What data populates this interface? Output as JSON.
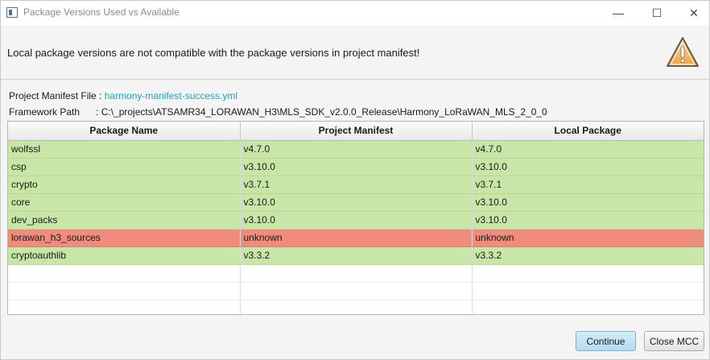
{
  "window": {
    "title": "Package Versions Used vs Available",
    "controls": {
      "minimize": "—",
      "maximize": "☐",
      "close": "✕"
    }
  },
  "header": {
    "message": "Local package versions are not compatible with the package versions in project manifest!",
    "icon": "warning-icon"
  },
  "info": {
    "manifest_label": "Project Manifest File :",
    "manifest_value": "harmony-manifest-success.yml",
    "framework_label": "Framework Path",
    "framework_sep": ":",
    "framework_value": "C:\\_projects\\ATSAMR34_LORAWAN_H3\\MLS_SDK_v2.0.0_Release\\Harmony_LoRaWAN_MLS_2_0_0"
  },
  "table": {
    "columns": [
      "Package Name",
      "Project Manifest",
      "Local Package"
    ],
    "rows": [
      {
        "name": "wolfssl",
        "manifest": "v4.7.0",
        "local": "v4.7.0",
        "status": "ok"
      },
      {
        "name": "csp",
        "manifest": "v3.10.0",
        "local": "v3.10.0",
        "status": "ok"
      },
      {
        "name": "crypto",
        "manifest": "v3.7.1",
        "local": "v3.7.1",
        "status": "ok"
      },
      {
        "name": "core",
        "manifest": "v3.10.0",
        "local": "v3.10.0",
        "status": "ok"
      },
      {
        "name": "dev_packs",
        "manifest": "v3.10.0",
        "local": "v3.10.0",
        "status": "ok"
      },
      {
        "name": "lorawan_h3_sources",
        "manifest": "unknown",
        "local": "unknown",
        "status": "bad"
      },
      {
        "name": "cryptoauthlib",
        "manifest": "v3.3.2",
        "local": "v3.3.2",
        "status": "ok"
      }
    ]
  },
  "colors": {
    "ok": "#c8e6a8",
    "bad": "#f08c7e",
    "link": "#17a7b7"
  },
  "buttons": {
    "continue": "Continue",
    "close": "Close MCC"
  }
}
